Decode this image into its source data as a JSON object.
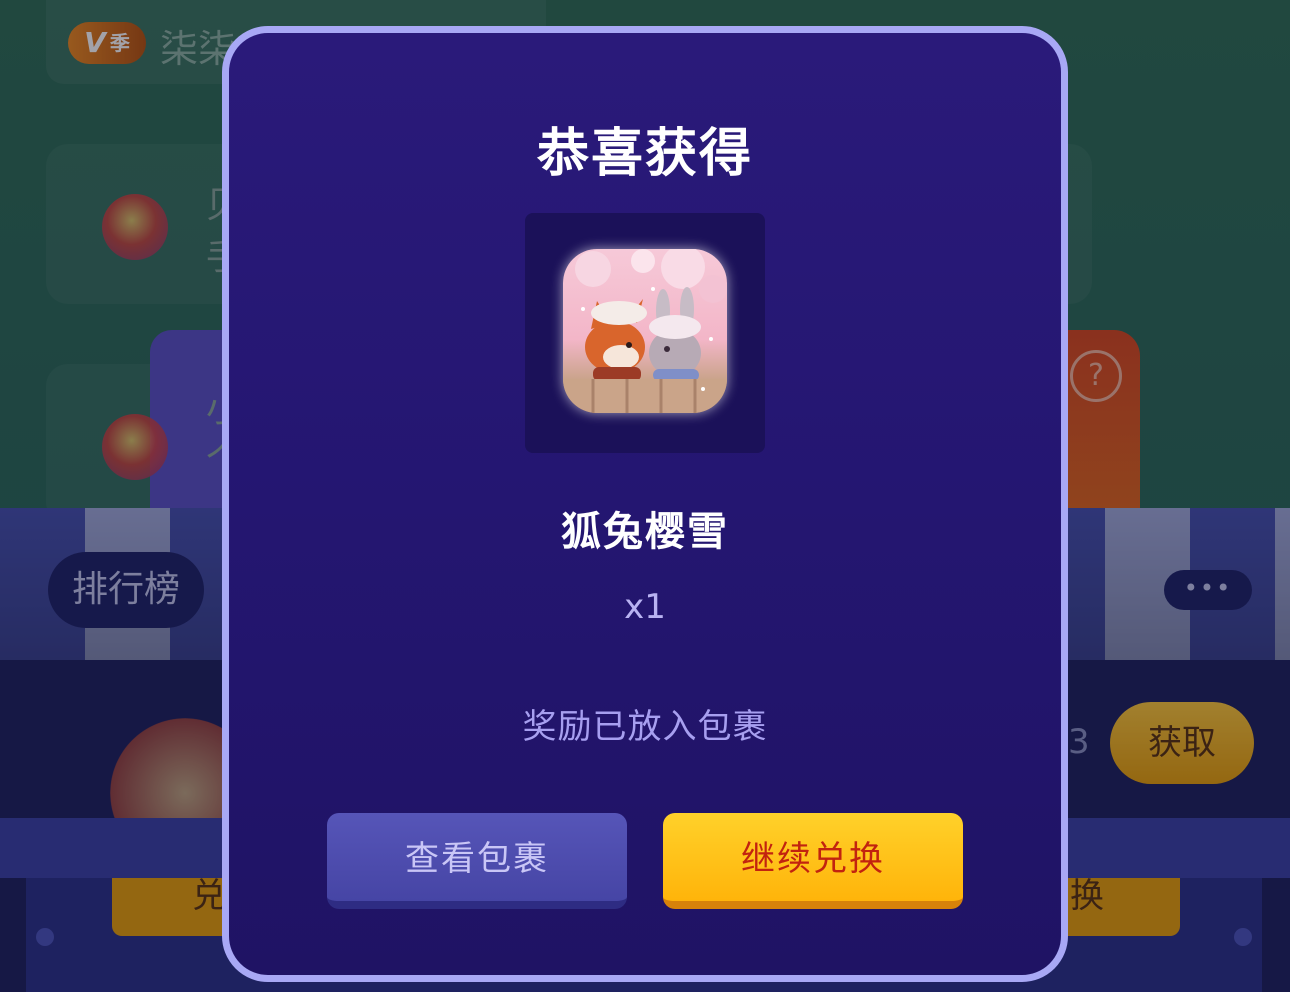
{
  "background": {
    "season_badge": {
      "v": "V",
      "label": "季"
    },
    "season_name": "柒柒",
    "task_items": [
      {
        "line1": "贝",
        "line2": "手"
      },
      {
        "line1": "小",
        "line2": "个"
      }
    ],
    "help_symbol": "?",
    "rank_button": "排行榜",
    "more_button": "•••",
    "count_text": "3",
    "get_button": "获取",
    "left_exchange_fragment": "兑",
    "right_exchange_fragment": "换"
  },
  "modal": {
    "title": "恭喜获得",
    "prize": {
      "image_alt": "fox-and-bunny-sakura-snow-illustration",
      "name": "狐兔樱雪",
      "quantity": "x1"
    },
    "note": "奖励已放入包裹",
    "buttons": {
      "view_package": "查看包裹",
      "continue_exchange": "继续兑换"
    }
  },
  "colors": {
    "modal_bg": "#241671",
    "modal_border": "#a8a8f5",
    "primary_button": "#ffc11a",
    "primary_text": "#c2230f",
    "secondary_button": "#4f4eb0"
  }
}
